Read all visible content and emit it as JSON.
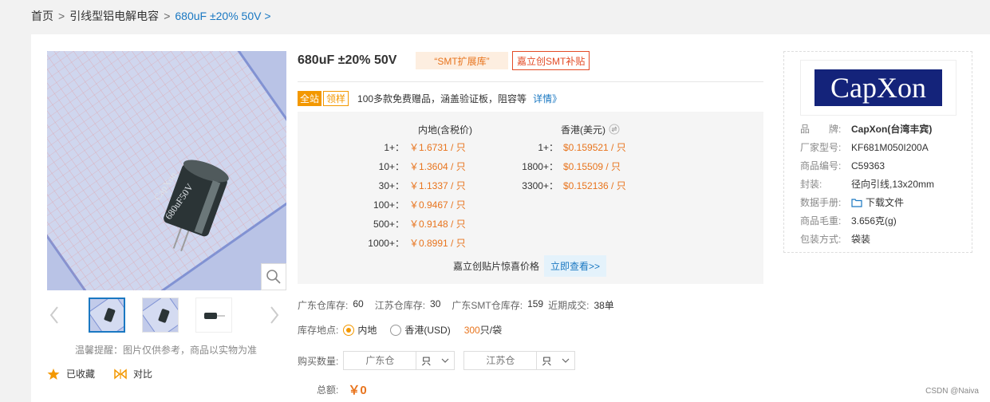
{
  "breadcrumb": {
    "home": "首页",
    "sep": ">",
    "category": "引线型铝电解电容",
    "current": "680uF ±20% 50V"
  },
  "gallery": {
    "tip": "温馨提醒：图片仅供参考，商品以实物为准",
    "fav_label": "已收藏",
    "compare_label": "对比",
    "product_print_brand": "CapXon",
    "product_print_spec": "680uF50V"
  },
  "product": {
    "title": "680uF ±20% 50V",
    "tag_smt": "“SMT扩展库”",
    "tag_subsidy": "嘉立创SMT补贴"
  },
  "promo": {
    "badge_all": "全站",
    "badge_sample": "领样",
    "text": "100多款免费赠品，涵盖验证板，阻容等",
    "link": "详情》"
  },
  "pricing": {
    "cn_header": "内地(含税价)",
    "hk_header": "香港(美元)",
    "cn_rows": [
      {
        "qty": "1+：",
        "price": "￥1.6731 / 只"
      },
      {
        "qty": "10+：",
        "price": "￥1.3604 / 只"
      },
      {
        "qty": "30+：",
        "price": "￥1.1337 / 只"
      },
      {
        "qty": "100+：",
        "price": "￥0.9467 / 只"
      },
      {
        "qty": "500+：",
        "price": "￥0.9148 / 只"
      },
      {
        "qty": "1000+：",
        "price": "￥0.8991 / 只"
      }
    ],
    "hk_rows": [
      {
        "qty": "1+：",
        "price": "$0.159521 / 只"
      },
      {
        "qty": "1800+：",
        "price": "$0.15509 / 只"
      },
      {
        "qty": "3300+：",
        "price": "$0.152136 / 只"
      }
    ],
    "surprise_text": "嘉立创贴片惊喜价格",
    "surprise_btn": "立即查看>>"
  },
  "stock": {
    "gd_label": "广东仓库存:",
    "gd_value": "60",
    "js_label": "江苏仓库存:",
    "js_value": "30",
    "smt_label": "广东SMT仓库存:",
    "smt_value": "159",
    "recent_label": "近期成交:",
    "recent_value": "38单"
  },
  "location": {
    "label": "库存地点:",
    "opt_cn": "内地",
    "opt_hk": "香港(USD)",
    "pkg_num": "300",
    "pkg_unit": "只/袋"
  },
  "purchase": {
    "label": "购买数量:",
    "gd_placeholder": "广东仓",
    "js_placeholder": "江苏仓",
    "unit": "只"
  },
  "total": {
    "label": "总额:",
    "value": "￥0"
  },
  "brand": {
    "logo_text": "CapXon",
    "rows": [
      {
        "k": "品　　牌:",
        "v": "CapXon(台湾丰宾)",
        "bold": true
      },
      {
        "k": "厂家型号:",
        "v": "KF681M050I200A"
      },
      {
        "k": "商品编号:",
        "v": "C59363"
      },
      {
        "k": "封装:",
        "v": "径向引线,13x20mm"
      },
      {
        "k": "数据手册:",
        "v": "下载文件"
      },
      {
        "k": "商品毛重:",
        "v": "3.656克(g)"
      },
      {
        "k": "包装方式:",
        "v": "袋装"
      }
    ]
  },
  "watermark": "CSDN @Naiva",
  "colors": {
    "accent_orange": "#e8741d",
    "link_blue": "#1a78c2",
    "brand_navy": "#14237a",
    "badge_orange": "#f39800"
  }
}
